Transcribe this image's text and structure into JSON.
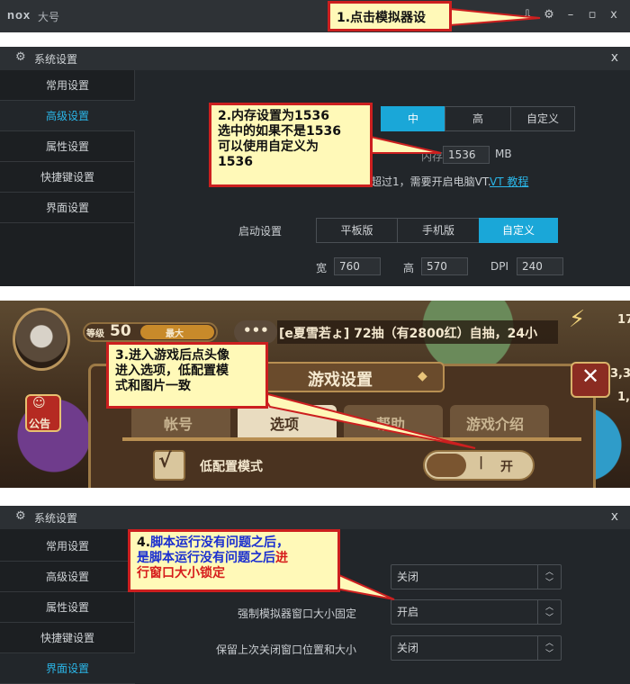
{
  "titlebar": {
    "logo": "nox",
    "app_name": "大号",
    "icons": [
      "down-icon",
      "gear-icon",
      "minimize-icon",
      "maximize-icon",
      "close-icon"
    ]
  },
  "callouts": {
    "c1": "1.点击模拟器设",
    "c2_l1": "2.内存设置为1536",
    "c2_l2": "选中的如果不是1536",
    "c2_l3": "可以使用自定义为",
    "c2_l4": "1536",
    "c3_l1": "3.进入游戏后点头像",
    "c3_l2": "进入选项，低配置模",
    "c3_l3": "式和图片一致",
    "c4_l1a": "4.",
    "c4_l1b": "脚本运行没有问题之后，",
    "c4_l2a": "是脚本运行没有问题之后",
    "c4_l2b": "进",
    "c4_l3": "行窗口大小锁定"
  },
  "settings1": {
    "title": "系统设置",
    "close": "x",
    "sidebar": [
      "常用设置",
      "高级设置",
      "属性设置",
      "快捷键设置",
      "界面设置"
    ],
    "active_index": 1,
    "perf_segments": [
      "中",
      "高",
      "自定义"
    ],
    "mem_label": "内存",
    "mem_value": "1536",
    "mem_unit": "MB",
    "vt_text": "超过1，需要开启电脑VT.",
    "vt_link": "VT 教程",
    "boot_label": "启动设置",
    "boot_segments": [
      "平板版",
      "手机版",
      "自定义"
    ],
    "width_label": "宽",
    "width_value": "760",
    "height_label": "高",
    "height_value": "570",
    "dpi_label": "DPI",
    "dpi_value": "240"
  },
  "game": {
    "level_label": "等级",
    "level_value": "50",
    "max_label": "最大",
    "chat_text": "[e夏雪若ょ] 72抽（有2800红）自抽，24小",
    "settings_title": "游戏设置",
    "tabs": [
      "帐号",
      "选项",
      "帮助",
      "游戏介绍"
    ],
    "low_mode_label": "低配置模式",
    "toggle_on": "开",
    "badge": "公告",
    "side_numbers": [
      "17",
      "3,3",
      "1,"
    ]
  },
  "settings2": {
    "title": "系统设置",
    "close": "x",
    "sidebar": [
      "常用设置",
      "高级设置",
      "属性设置",
      "快捷键设置",
      "界面设置"
    ],
    "active_index": 4,
    "rows": [
      {
        "label": "",
        "value": "关闭"
      },
      {
        "label": "强制模拟器窗口大小固定",
        "value": "开启"
      },
      {
        "label": "保留上次关闭窗口位置和大小",
        "value": "关闭"
      }
    ]
  },
  "colors": {
    "accent": "#1aa7d8",
    "callout_bg": "#fff9b8",
    "callout_border": "#cc1f1f"
  }
}
